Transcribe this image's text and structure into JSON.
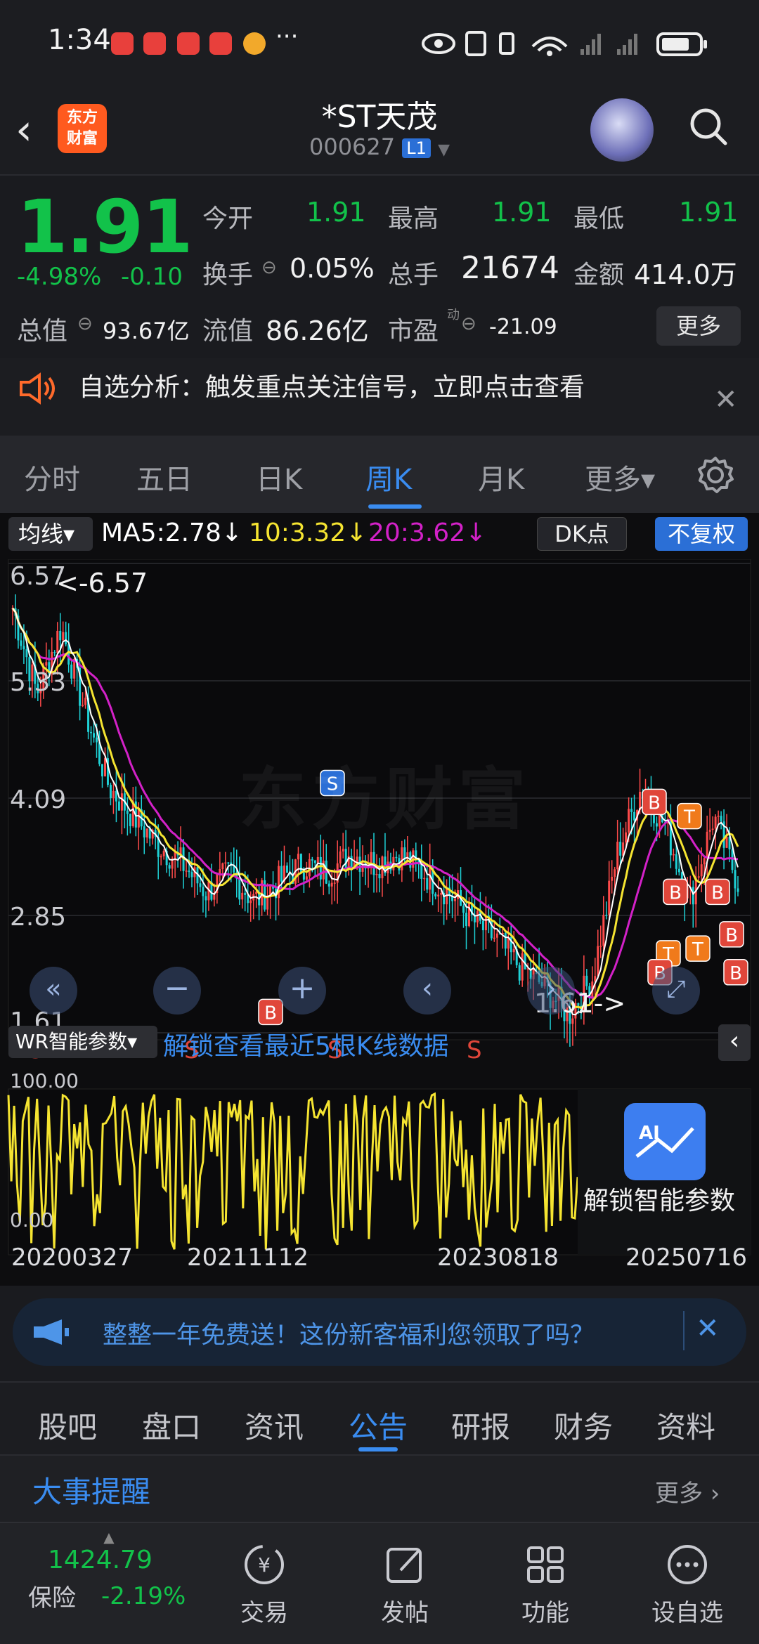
{
  "status_bar": {
    "time": "1:34",
    "dots": "···"
  },
  "header": {
    "title": "*ST天茂",
    "code": "000627",
    "level_badge": "L1",
    "logo_line1": "东方",
    "logo_line2": "财富"
  },
  "quote": {
    "price": "1.91",
    "change_pct": "-4.98%",
    "change_abs": "-0.10",
    "open_label": "今开",
    "open_value": "1.91",
    "high_label": "最高",
    "high_value": "1.91",
    "low_label": "最低",
    "low_value": "1.91",
    "turnover_label": "换手",
    "turnover_value": "0.05%",
    "volume_label": "总手",
    "volume_value": "21674",
    "amount_label": "金额",
    "amount_value": "414.0万",
    "mktcap_label": "总值",
    "mktcap_value": "93.67亿",
    "float_label": "流值",
    "float_value": "86.26亿",
    "pe_label": "市盈",
    "pe_sup": "动",
    "pe_value": "-21.09",
    "more_button": "更多"
  },
  "notice": {
    "text": "自选分析：触发重点关注信号，立即点击查看"
  },
  "chart_tabs": [
    "分时",
    "五日",
    "日K",
    "周K",
    "月K",
    "更多▾"
  ],
  "active_chart_tab": "周K",
  "chart_toolbar": {
    "ma_selector": "均线▾",
    "ma5": "MA5:2.78↓",
    "ma10": "10:3.32↓",
    "ma20": "20:3.62↓",
    "dk_button": "DK点",
    "adjust_button": "不复权",
    "ma5_color": "#ffffff",
    "ma10_color": "#f5e431",
    "ma20_color": "#d321c8"
  },
  "chart_data": {
    "type": "candlestick",
    "y_ticks": [
      "6.57",
      "5.33",
      "4.09",
      "2.85",
      "1.61"
    ],
    "ylim": [
      1.61,
      6.57
    ],
    "max_marker": "<-6.57",
    "min_marker": "1.61->",
    "watermark": "东方财富",
    "x_labels": [
      "20200327",
      "20211112",
      "20230818",
      "20250716"
    ],
    "ma5_close_trend": [
      6.1,
      5.2,
      5.9,
      5.0,
      4.2,
      3.9,
      3.6,
      3.4,
      3.1,
      3.3,
      3.0,
      3.2,
      3.4,
      3.3,
      3.5,
      3.4,
      3.5,
      3.3,
      3.1,
      2.8,
      2.6,
      2.3,
      2.1,
      1.8,
      2.2,
      3.5,
      4.2,
      3.8,
      3.0,
      3.9,
      3.2
    ],
    "signal_labels": [
      "B",
      "S",
      "T"
    ],
    "indicator": {
      "name": "WR智能参数▾",
      "unlock_text": "解锁查看最近5根K线数据",
      "top": "100.00",
      "bottom": "0.00",
      "ai_unlock_label": "解锁智能参数",
      "ai_badge": "AI"
    }
  },
  "promo": {
    "text": "整整一年免费送！这份新客福利您领取了吗？"
  },
  "bottom_tabs": [
    "股吧",
    "盘口",
    "资讯",
    "公告",
    "研报",
    "财务",
    "资料"
  ],
  "active_bottom_tab": "公告",
  "events": {
    "title": "大事提醒",
    "more": "更多"
  },
  "bottom_nav": {
    "index_value": "1424.79",
    "index_name": "保险",
    "index_change": "-2.19%",
    "items": [
      "交易",
      "发帖",
      "功能",
      "设自选"
    ]
  }
}
